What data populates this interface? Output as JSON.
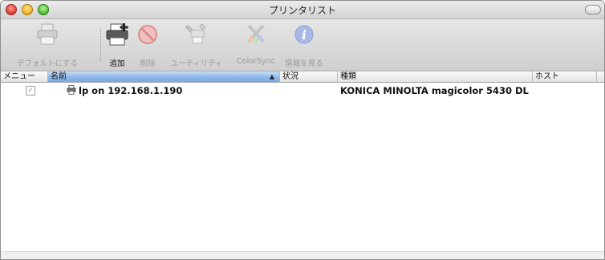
{
  "window": {
    "title": "プリンタリスト"
  },
  "toolbar": {
    "items": [
      {
        "label": "デフォルトにする",
        "icon": "printer-default-icon",
        "enabled": false
      },
      {
        "label": "追加",
        "icon": "add-printer-icon",
        "enabled": true
      },
      {
        "label": "削除",
        "icon": "delete-icon",
        "enabled": false
      },
      {
        "label": "ユーティリティ",
        "icon": "utility-icon",
        "enabled": false
      },
      {
        "label": "ColorSync",
        "icon": "colorsync-icon",
        "enabled": false
      },
      {
        "label": "情報を見る",
        "icon": "info-icon",
        "enabled": false
      }
    ]
  },
  "table": {
    "columns": [
      "メニュー",
      "名前",
      "状況",
      "種類",
      "ホスト"
    ],
    "sort_indicator": "▲",
    "rows": [
      {
        "in_menu": "✓",
        "name": "lp on 192.168.1.190",
        "status": "",
        "kind": "KONICA MINOLTA magicolor 5430 DL",
        "host": ""
      }
    ]
  },
  "colors": {
    "selected_column": "#8fb8e8",
    "disabled_text": "#9a9a9a"
  }
}
